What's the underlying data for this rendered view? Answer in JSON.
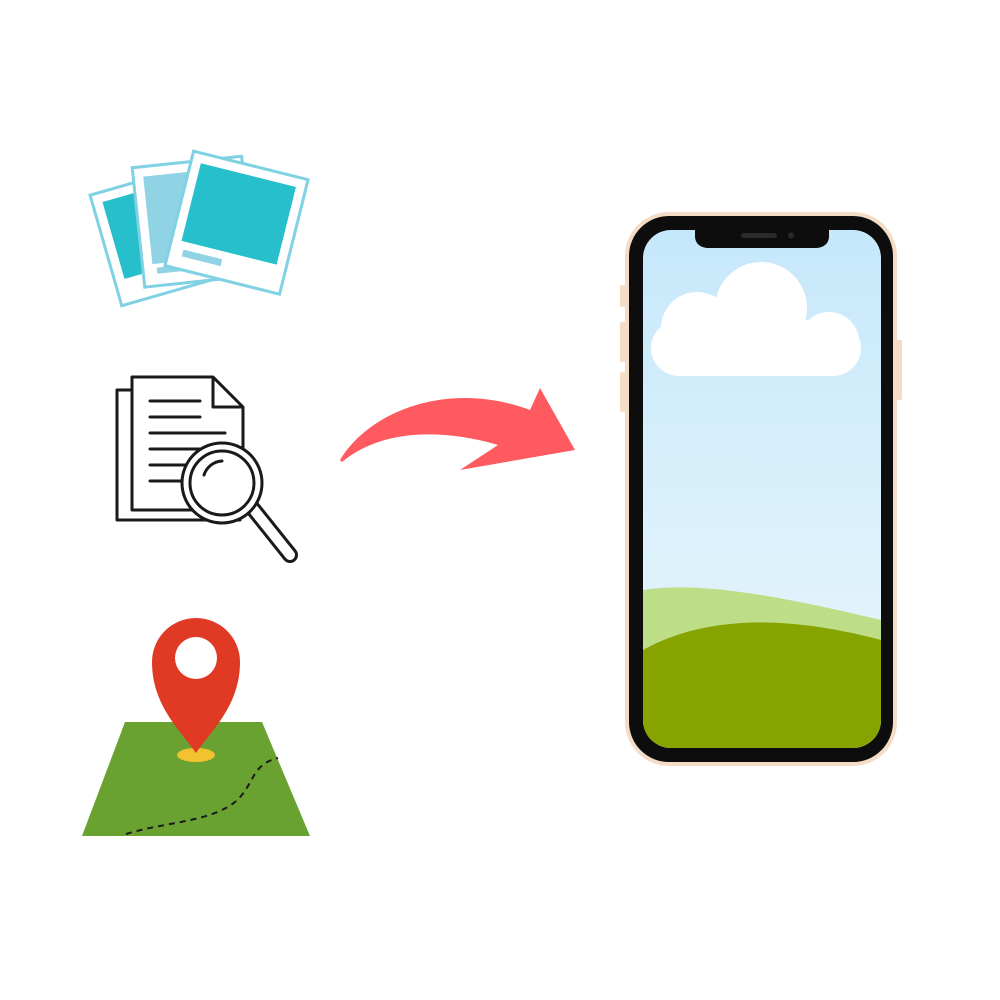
{
  "icons": [
    {
      "id": "photos",
      "name": "photo-stack-icon"
    },
    {
      "id": "document",
      "name": "document-search-icon"
    },
    {
      "id": "map",
      "name": "map-location-pin-icon"
    }
  ],
  "arrow": {
    "name": "curved-arrow-icon"
  },
  "phone": {
    "name": "smartphone",
    "screen": "sky-and-hills-wallpaper"
  },
  "colors": {
    "background": "#ffffff",
    "photo_teal": "#26bfcb",
    "photo_light": "#8fd3e4",
    "photo_border": "#7fd1e3",
    "document_stroke": "#1a1a1a",
    "pin_red": "#e03a24",
    "pin_base": "#f2c230",
    "map_green": "#6aa231",
    "arrow_red": "#ff5a5f",
    "phone_frame": "#0d0d0d",
    "phone_bezel_edge": "#f5dcc6",
    "sky_top": "#c6e8fb",
    "sky_bottom": "#eaf7fb",
    "hill_light": "#bedd87",
    "hill_dark": "#86a300",
    "cloud": "#ffffff"
  }
}
